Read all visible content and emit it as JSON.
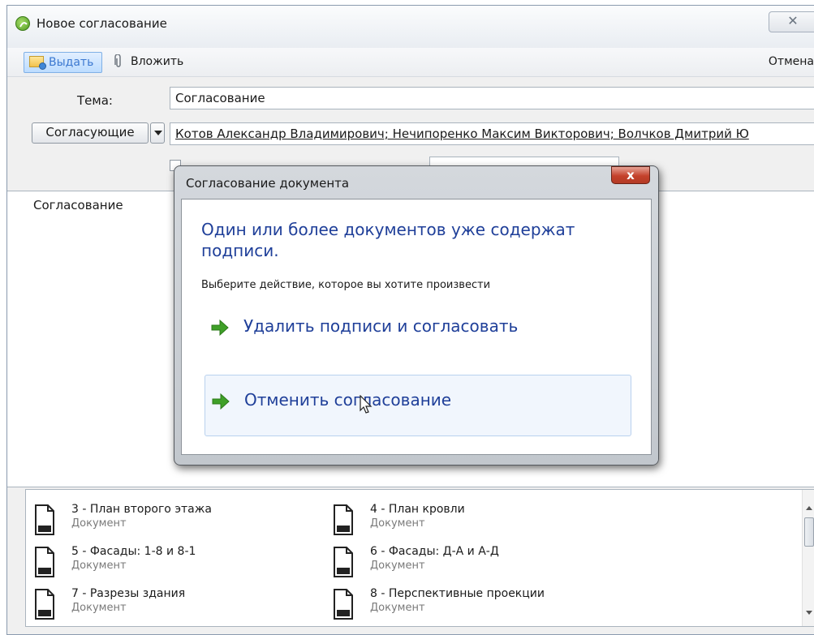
{
  "window": {
    "title": "Новое согласование",
    "close_glyph": "✕",
    "logo_icon": "app-logo-icon"
  },
  "toolbar": {
    "issue_label": "Выдать",
    "attach_label": "Вложить",
    "cancel_label": "Отмена"
  },
  "form": {
    "topic_label": "Тема:",
    "topic_value": "Согласование",
    "approvers_button": "Согласующие",
    "approvers_value": "Котов Александр Владимирович; Нечипоренко Максим Викторович; Волчков Дмитрий Ю"
  },
  "body": {
    "text": "Согласование"
  },
  "documents": [
    {
      "title": "3 - План второго этажа",
      "type": "Документ"
    },
    {
      "title": "4 - План кровли",
      "type": "Документ"
    },
    {
      "title": "5 - Фасады: 1-8 и 8-1",
      "type": "Документ"
    },
    {
      "title": "6 - Фасады: Д-А и А-Д",
      "type": "Документ"
    },
    {
      "title": "7 - Разрезы здания",
      "type": "Документ"
    },
    {
      "title": "8 - Перспективные проекции",
      "type": "Документ"
    }
  ],
  "dialog": {
    "title": "Согласование документа",
    "close_glyph": "x",
    "heading": "Один или более документов уже содержат подписи.",
    "subtext": "Выберите действие, которое вы хотите произвести",
    "actions": [
      {
        "label": "Удалить подписи и согласовать",
        "icon": "green-arrow-icon"
      },
      {
        "label": "Отменить согласование",
        "icon": "green-arrow-icon"
      }
    ]
  },
  "colors": {
    "accent_blue": "#1f3f99",
    "arrow_green": "#3fa028",
    "dialog_close_red": "#c4412b"
  }
}
